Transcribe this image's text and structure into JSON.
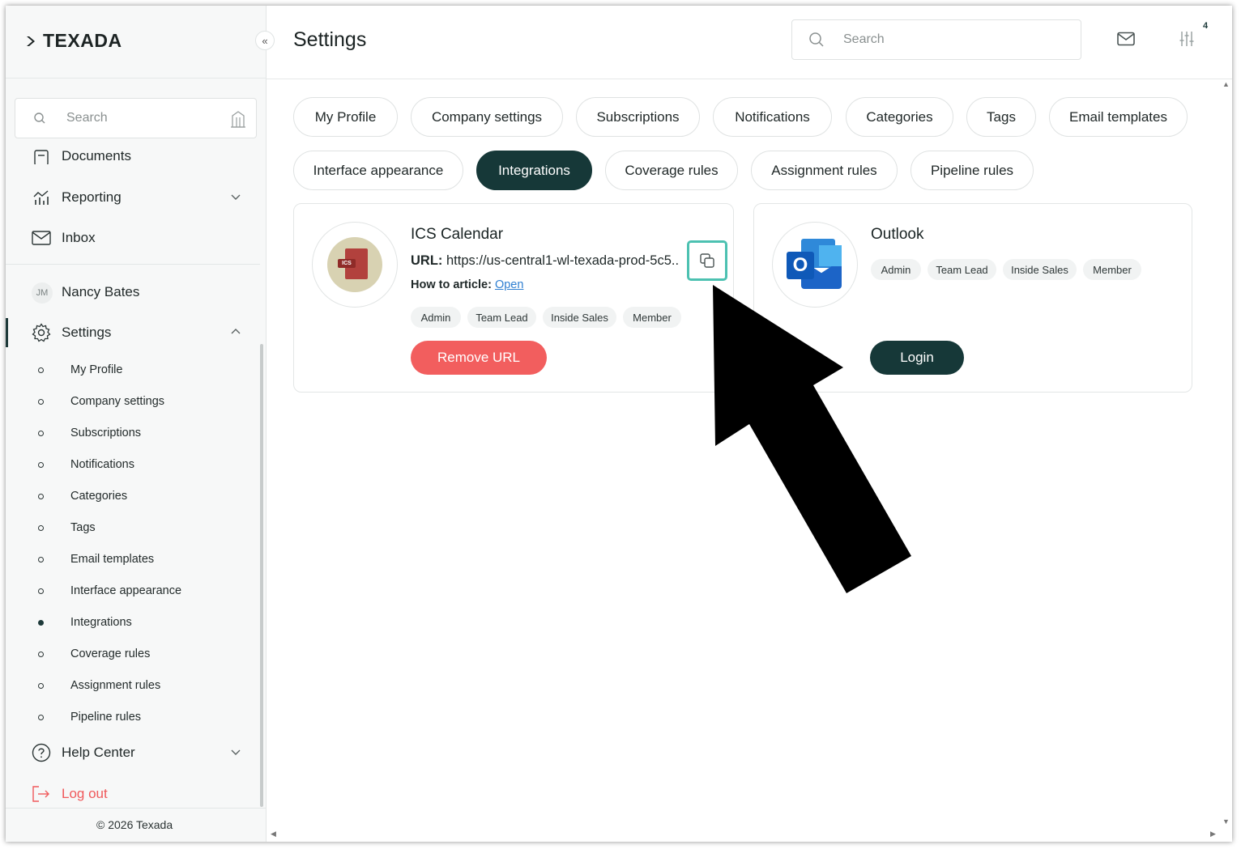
{
  "brand": {
    "name": "TEXADA"
  },
  "sidebar": {
    "search_placeholder": "Search",
    "items": {
      "documents": "Documents",
      "reporting": "Reporting",
      "inbox": "Inbox",
      "user_initials": "JM",
      "user_name": "Nancy Bates",
      "settings": "Settings",
      "help": "Help Center",
      "logout": "Log out"
    },
    "settings_sub": [
      "My Profile",
      "Company settings",
      "Subscriptions",
      "Notifications",
      "Categories",
      "Tags",
      "Email templates",
      "Interface appearance",
      "Integrations",
      "Coverage rules",
      "Assignment rules",
      "Pipeline rules"
    ],
    "footer": "© 2026 Texada"
  },
  "header": {
    "title": "Settings",
    "search_placeholder": "Search",
    "notification_count": "4"
  },
  "tabs": [
    "My Profile",
    "Company settings",
    "Subscriptions",
    "Notifications",
    "Categories",
    "Tags",
    "Email templates",
    "Interface appearance",
    "Integrations",
    "Coverage rules",
    "Assignment rules",
    "Pipeline rules"
  ],
  "active_tab": "Integrations",
  "integrations": {
    "ics": {
      "title": "ICS Calendar",
      "icon_text": "ICS",
      "url_label": "URL:",
      "url_value": "https://us-central1-wl-texada-prod-5c5..",
      "how_label": "How to article:",
      "how_link": "Open",
      "roles": [
        "Admin",
        "Team Lead",
        "Inside Sales",
        "Member"
      ],
      "remove_label": "Remove URL"
    },
    "outlook": {
      "title": "Outlook",
      "icon_letter": "O",
      "roles": [
        "Admin",
        "Team Lead",
        "Inside Sales",
        "Member"
      ],
      "login_label": "Login"
    }
  },
  "colors": {
    "primary": "#163838",
    "danger": "#f25e5e",
    "highlight": "#4cc1b1",
    "link": "#2f7fd1"
  }
}
